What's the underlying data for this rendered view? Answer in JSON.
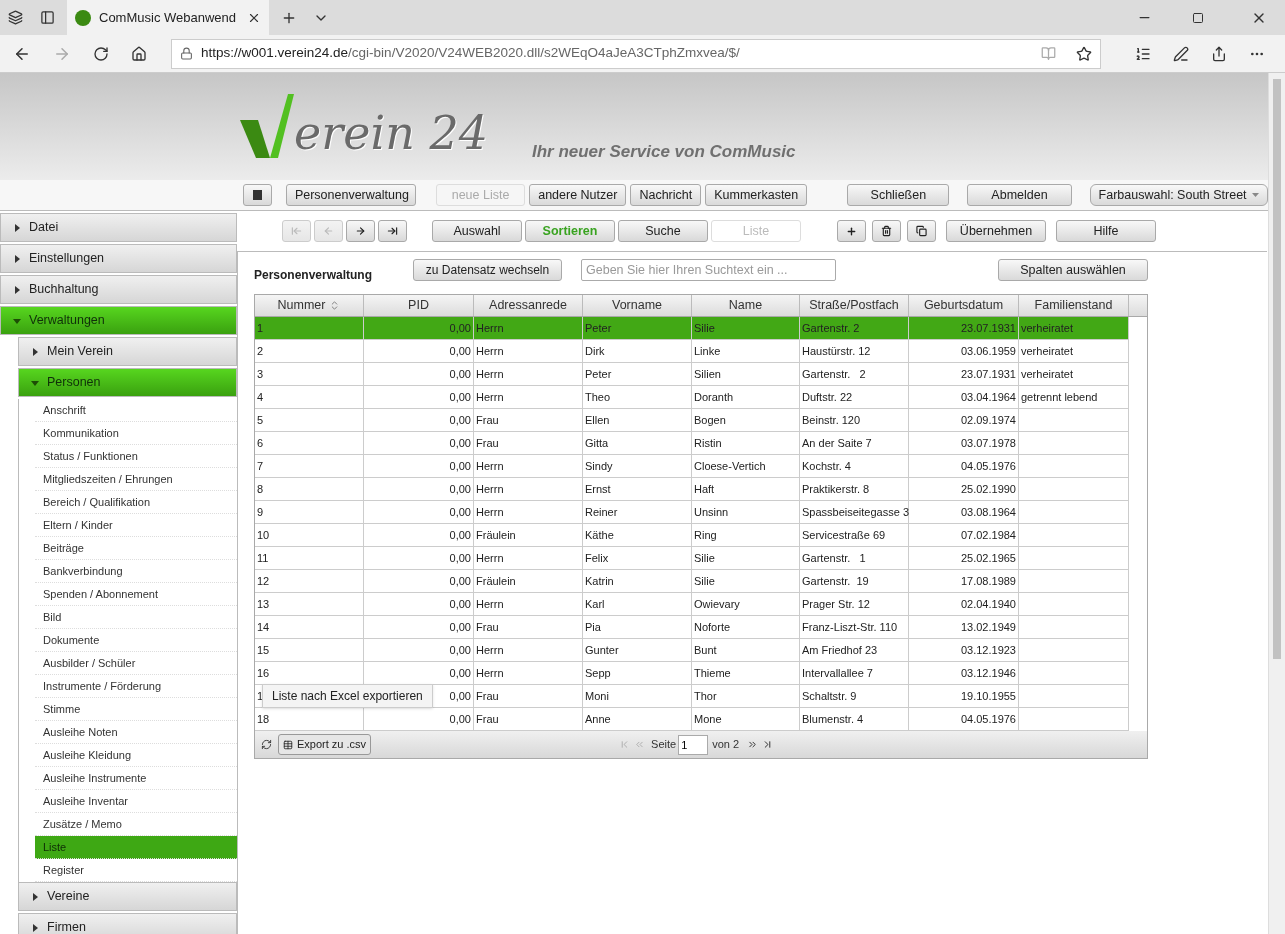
{
  "browser": {
    "tab_title": "ComMusic Webanwend",
    "url_host": "https://w001.verein24.de",
    "url_path": "/cgi-bin/V2020/V24WEB2020.dll/s2WEqO4aJeA3CTphZmxvea/$/"
  },
  "banner": {
    "logo_text": "erein 24",
    "slogan": "Ihr neuer Service von ComMusic"
  },
  "top_toolbar": [
    {
      "kind": "icon"
    },
    {
      "kind": "button",
      "label": "Personenverwaltung",
      "disabled": false
    },
    {
      "kind": "button",
      "label": "neue Liste",
      "disabled": true
    },
    {
      "kind": "button",
      "label": "andere Nutzer",
      "disabled": false
    },
    {
      "kind": "button",
      "label": "Nachricht",
      "disabled": false
    },
    {
      "kind": "button",
      "label": "Kummerkasten",
      "disabled": false
    },
    {
      "kind": "button",
      "label": "Schließen",
      "disabled": false
    },
    {
      "kind": "button",
      "label": "Abmelden",
      "disabled": false
    },
    {
      "kind": "select",
      "label": "Farbauswahl: South Street"
    }
  ],
  "nav_toolbar": {
    "record_buttons": [
      {
        "kind": "first",
        "disabled": true
      },
      {
        "kind": "prev",
        "disabled": true
      },
      {
        "kind": "next",
        "disabled": false
      },
      {
        "kind": "last",
        "disabled": false
      }
    ],
    "view_buttons": [
      {
        "label": "Auswahl",
        "selected": false,
        "disabled": false
      },
      {
        "label": "Sortieren",
        "selected": true,
        "disabled": false
      },
      {
        "label": "Suche",
        "selected": false,
        "disabled": false
      },
      {
        "label": "Liste",
        "selected": false,
        "disabled": true
      }
    ],
    "action_icons": [
      {
        "kind": "add"
      },
      {
        "kind": "delete"
      },
      {
        "kind": "copy"
      }
    ],
    "action_buttons": [
      "Übernehmen",
      "Hilfe"
    ]
  },
  "sidebar": [
    {
      "label": "Datei",
      "kind": "group",
      "expanded": false
    },
    {
      "label": "Einstellungen",
      "kind": "group",
      "expanded": false
    },
    {
      "label": "Buchhaltung",
      "kind": "group",
      "expanded": false
    },
    {
      "label": "Verwaltungen",
      "kind": "group",
      "expanded": true,
      "children": [
        {
          "label": "Mein Verein",
          "kind": "group",
          "expanded": false
        },
        {
          "label": "Personen",
          "kind": "group",
          "expanded": true,
          "children": [
            {
              "label": "Anschrift",
              "kind": "link",
              "selected": false
            },
            {
              "label": "Kommunikation",
              "kind": "link",
              "selected": false
            },
            {
              "label": "Status / Funktionen",
              "kind": "link",
              "selected": false
            },
            {
              "label": "Mitgliedszeiten / Ehrungen",
              "kind": "link",
              "selected": false
            },
            {
              "label": "Bereich / Qualifikation",
              "kind": "link",
              "selected": false
            },
            {
              "label": "Eltern / Kinder",
              "kind": "link",
              "selected": false
            },
            {
              "label": "Beiträge",
              "kind": "link",
              "selected": false
            },
            {
              "label": "Bankverbindung",
              "kind": "link",
              "selected": false
            },
            {
              "label": "Spenden / Abonnement",
              "kind": "link",
              "selected": false
            },
            {
              "label": "Bild",
              "kind": "link",
              "selected": false
            },
            {
              "label": "Dokumente",
              "kind": "link",
              "selected": false
            },
            {
              "label": "Ausbilder / Schüler",
              "kind": "link",
              "selected": false
            },
            {
              "label": "Instrumente / Förderung",
              "kind": "link",
              "selected": false
            },
            {
              "label": "Stimme",
              "kind": "link",
              "selected": false
            },
            {
              "label": "Ausleihe Noten",
              "kind": "link",
              "selected": false
            },
            {
              "label": "Ausleihe Kleidung",
              "kind": "link",
              "selected": false
            },
            {
              "label": "Ausleihe Instrumente",
              "kind": "link",
              "selected": false
            },
            {
              "label": "Ausleihe Inventar",
              "kind": "link",
              "selected": false
            },
            {
              "label": "Zusätze / Memo",
              "kind": "link",
              "selected": false
            },
            {
              "label": "Liste",
              "kind": "link",
              "selected": true
            },
            {
              "label": "Register",
              "kind": "link",
              "selected": false
            }
          ]
        },
        {
          "label": "Vereine",
          "kind": "group",
          "expanded": false
        },
        {
          "label": "Firmen",
          "kind": "group",
          "expanded": false
        }
      ]
    }
  ],
  "panel": {
    "title": "Personenverwaltung",
    "goto_button": "zu Datensatz wechseln",
    "search_placeholder": "Geben Sie hier Ihren Suchtext ein ...",
    "columns_button": "Spalten auswählen"
  },
  "table": {
    "columns": [
      {
        "label": "Nummer",
        "sorted": true
      },
      {
        "label": "PID",
        "sorted": false
      },
      {
        "label": "Adressanrede",
        "sorted": false
      },
      {
        "label": "Vorname",
        "sorted": false
      },
      {
        "label": "Name",
        "sorted": false
      },
      {
        "label": "Straße/Postfach",
        "sorted": false
      },
      {
        "label": "Geburtsdatum",
        "sorted": false
      },
      {
        "label": "Familienstand",
        "sorted": false
      }
    ],
    "rows": [
      {
        "selected": true,
        "cells": [
          "1",
          "0,00",
          "Herrn",
          "Peter",
          "Silie",
          "Gartenstr. 2",
          "23.07.1931",
          "verheiratet"
        ]
      },
      {
        "selected": false,
        "cells": [
          "2",
          "0,00",
          "Herrn",
          "Dirk",
          "Linke",
          "Haustürstr. 12",
          "03.06.1959",
          "verheiratet"
        ]
      },
      {
        "selected": false,
        "cells": [
          "3",
          "0,00",
          "Herrn",
          "Peter",
          "Silien",
          "Gartenstr.   2",
          "23.07.1931",
          "verheiratet"
        ]
      },
      {
        "selected": false,
        "cells": [
          "4",
          "0,00",
          "Herrn",
          "Theo",
          "Doranth",
          "Duftstr. 22",
          "03.04.1964",
          "getrennt lebend"
        ]
      },
      {
        "selected": false,
        "cells": [
          "5",
          "0,00",
          "Frau",
          "Ellen",
          "Bogen",
          "Beinstr. 120",
          "02.09.1974",
          ""
        ]
      },
      {
        "selected": false,
        "cells": [
          "6",
          "0,00",
          "Frau",
          "Gitta",
          "Ristin",
          "An der Saite 7",
          "03.07.1978",
          ""
        ]
      },
      {
        "selected": false,
        "cells": [
          "7",
          "0,00",
          "Herrn",
          "Sindy",
          "Cloese-Vertich",
          "Kochstr. 4",
          "04.05.1976",
          ""
        ]
      },
      {
        "selected": false,
        "cells": [
          "8",
          "0,00",
          "Herrn",
          "Ernst",
          "Haft",
          "Praktikerstr. 8",
          "25.02.1990",
          ""
        ]
      },
      {
        "selected": false,
        "cells": [
          "9",
          "0,00",
          "Herrn",
          "Reiner",
          "Unsinn",
          "Spassbeiseitegasse 3",
          "03.08.1964",
          ""
        ]
      },
      {
        "selected": false,
        "cells": [
          "10",
          "0,00",
          "Fräulein",
          "Käthe",
          "Ring",
          "Servicestraße 69",
          "07.02.1984",
          ""
        ]
      },
      {
        "selected": false,
        "cells": [
          "11",
          "0,00",
          "Herrn",
          "Felix",
          "Silie",
          "Gartenstr.   1",
          "25.02.1965",
          ""
        ]
      },
      {
        "selected": false,
        "cells": [
          "12",
          "0,00",
          "Fräulein",
          "Katrin",
          "Silie",
          "Gartenstr.  19",
          "17.08.1989",
          ""
        ]
      },
      {
        "selected": false,
        "cells": [
          "13",
          "0,00",
          "Herrn",
          "Karl",
          "Owievary",
          "Prager Str. 12",
          "02.04.1940",
          ""
        ]
      },
      {
        "selected": false,
        "cells": [
          "14",
          "0,00",
          "Frau",
          "Pia",
          "Noforte",
          "Franz-Liszt-Str. 110",
          "13.02.1949",
          ""
        ]
      },
      {
        "selected": false,
        "cells": [
          "15",
          "0,00",
          "Herrn",
          "Gunter",
          "Bunt",
          "Am Friedhof 23",
          "03.12.1923",
          ""
        ]
      },
      {
        "selected": false,
        "cells": [
          "16",
          "0,00",
          "Herrn",
          "Sepp",
          "Thieme",
          "Intervallallee 7",
          "03.12.1946",
          ""
        ]
      },
      {
        "selected": false,
        "cells": [
          "1",
          "0,00",
          "Frau",
          "Moni",
          "Thor",
          "Schaltstr. 9",
          "19.10.1955",
          ""
        ]
      },
      {
        "selected": false,
        "cells": [
          "18",
          "0,00",
          "Frau",
          "Anne",
          "Mone",
          "Blumenstr. 4",
          "04.05.1976",
          ""
        ]
      }
    ]
  },
  "tooltip": "Liste nach Excel exportieren",
  "pager": {
    "export_button": "Export zu .csv",
    "page_label": "Seite",
    "page_value": "1",
    "page_total": "von 2"
  }
}
